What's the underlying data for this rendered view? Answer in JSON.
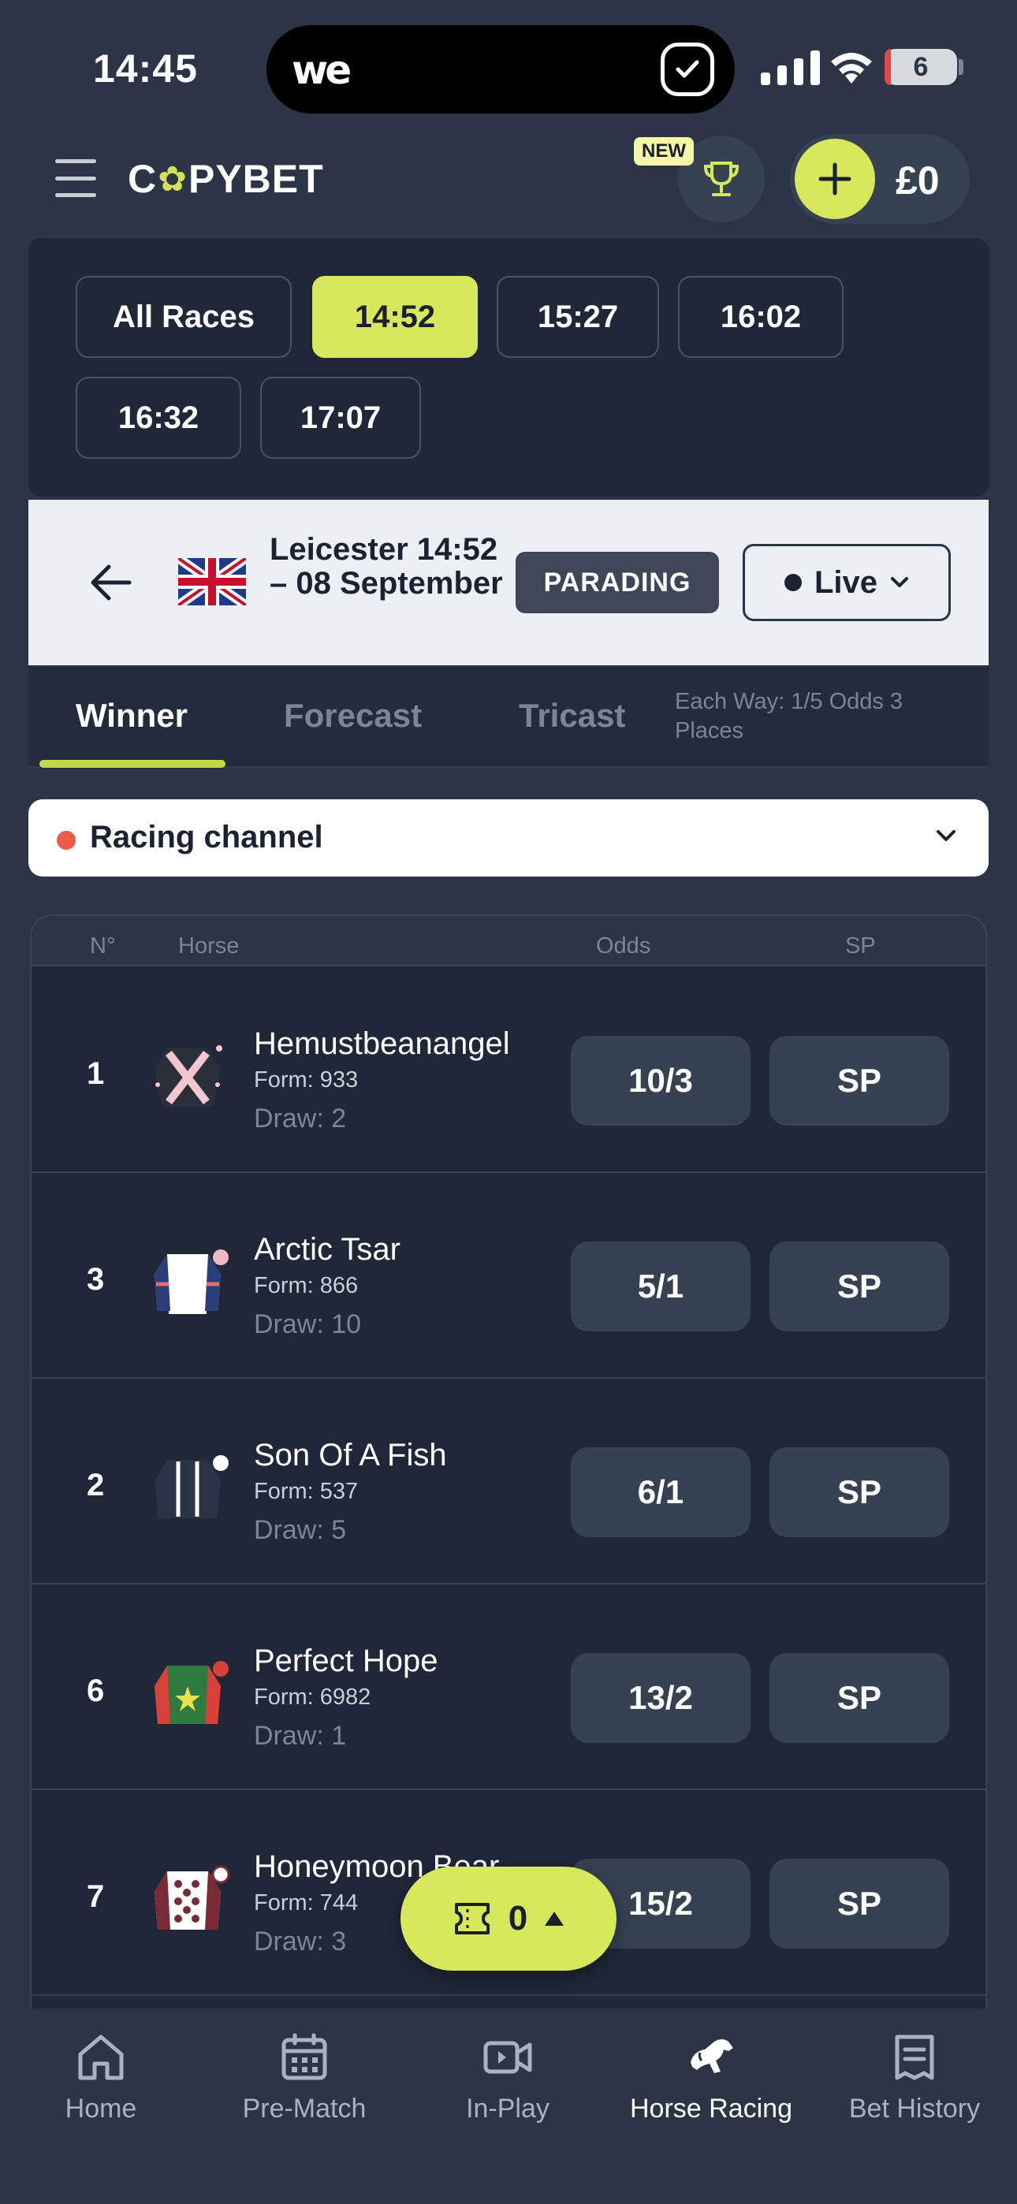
{
  "status_bar": {
    "time": "14:45",
    "battery": "6"
  },
  "header": {
    "brand_left": "C",
    "brand_right": "PYBET",
    "new_badge": "NEW",
    "balance": "£0"
  },
  "race_times": [
    "All Races",
    "14:52",
    "15:27",
    "16:02",
    "16:32",
    "17:07"
  ],
  "race": {
    "title": "Leicester 14:52 – 08 September",
    "status": "PARADING",
    "view_mode": "Live"
  },
  "market_tabs": [
    "Winner",
    "Forecast",
    "Tricast"
  ],
  "each_way": "Each Way: 1/5 Odds 3 Places",
  "channel": {
    "label": "Racing channel"
  },
  "table_headers": {
    "number": "N°",
    "horse": "Horse",
    "odds": "Odds",
    "sp": "SP"
  },
  "runners": [
    {
      "number": "1",
      "name": "Hemustbeanangel",
      "form": "Form: 933",
      "draw": "Draw: 2",
      "odds": "10/3",
      "sp": "SP",
      "silk": "silk-cross-icon"
    },
    {
      "number": "3",
      "name": "Arctic Tsar",
      "form": "Form: 866",
      "draw": "Draw: 10",
      "odds": "5/1",
      "sp": "SP",
      "silk": "silk-white-navy-icon"
    },
    {
      "number": "2",
      "name": "Son Of A Fish",
      "form": "Form: 537",
      "draw": "Draw: 5",
      "odds": "6/1",
      "sp": "SP",
      "silk": "silk-navy-braces-icon"
    },
    {
      "number": "6",
      "name": "Perfect Hope",
      "form": "Form: 6982",
      "draw": "Draw: 1",
      "odds": "13/2",
      "sp": "SP",
      "silk": "silk-green-star-icon"
    },
    {
      "number": "7",
      "name": "Honeymoon Bear",
      "form": "Form: 744",
      "draw": "Draw: 3",
      "odds": "15/2",
      "sp": "SP",
      "silk": "silk-maroon-stars-icon"
    }
  ],
  "betslip": {
    "count": "0"
  },
  "bottom_nav": [
    {
      "label": "Home",
      "icon": "home-icon"
    },
    {
      "label": "Pre-Match",
      "icon": "calendar-icon"
    },
    {
      "label": "In-Play",
      "icon": "video-icon"
    },
    {
      "label": "Horse Racing",
      "icon": "horse-icon"
    },
    {
      "label": "Bet History",
      "icon": "receipt-icon"
    }
  ],
  "colors": {
    "background": "#2c3546",
    "panel": "#1f2738",
    "accent": "#d7e85a",
    "live_dot": "#ee5a4a"
  }
}
